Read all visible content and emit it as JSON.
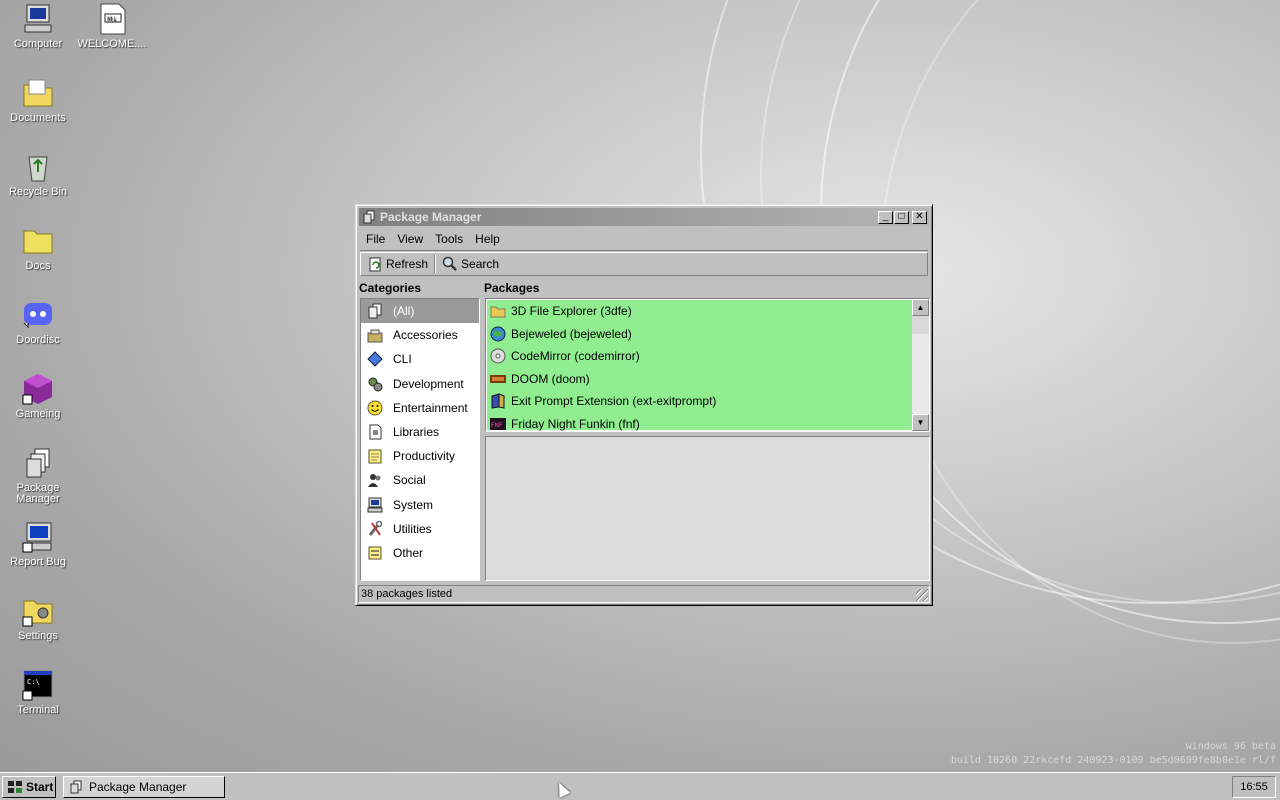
{
  "desktop": {
    "icons": [
      {
        "label": "Computer",
        "icon": "computer-icon"
      },
      {
        "label": "WELCOME....",
        "icon": "markdown-file-icon"
      },
      {
        "label": "Documents",
        "icon": "documents-folder-icon"
      },
      {
        "label": "Recycle Bin",
        "icon": "recycle-bin-icon"
      },
      {
        "label": "Docs",
        "icon": "folder-icon"
      },
      {
        "label": "Doordisc",
        "icon": "discord-icon"
      },
      {
        "label": "Gameing",
        "icon": "game-cube-icon"
      },
      {
        "label": "Package Manager",
        "icon": "package-manager-icon"
      },
      {
        "label": "Report Bug",
        "icon": "report-bug-icon"
      },
      {
        "label": "Settings",
        "icon": "settings-folder-icon"
      },
      {
        "label": "Terminal",
        "icon": "terminal-icon"
      }
    ],
    "watermark_line1": "windows 96 beta",
    "watermark_line2": "build 10260 22rkcefd 240923-0109 be5d0699fe8b0e1e rl/f"
  },
  "window": {
    "title": "Package Manager",
    "menu": [
      "File",
      "View",
      "Tools",
      "Help"
    ],
    "toolbar": {
      "refresh_label": "Refresh",
      "search_label": "Search"
    },
    "categories_heading": "Categories",
    "packages_heading": "Packages",
    "categories": [
      {
        "label": "(All)",
        "icon": "all-icon",
        "selected": true
      },
      {
        "label": "Accessories",
        "icon": "accessories-icon"
      },
      {
        "label": "CLI",
        "icon": "cli-diamond-icon"
      },
      {
        "label": "Development",
        "icon": "development-gears-icon"
      },
      {
        "label": "Entertainment",
        "icon": "smiley-icon"
      },
      {
        "label": "Libraries",
        "icon": "libraries-icon"
      },
      {
        "label": "Productivity",
        "icon": "productivity-notepad-icon"
      },
      {
        "label": "Social",
        "icon": "social-people-icon"
      },
      {
        "label": "System",
        "icon": "system-computer-icon"
      },
      {
        "label": "Utilities",
        "icon": "utilities-tools-icon"
      },
      {
        "label": "Other",
        "icon": "other-icon"
      }
    ],
    "packages": [
      {
        "label": "3D File Explorer (3dfe)",
        "icon": "folder-icon"
      },
      {
        "label": "Bejeweled (bejeweled)",
        "icon": "globe-icon"
      },
      {
        "label": "CodeMirror (codemirror)",
        "icon": "disc-icon"
      },
      {
        "label": "DOOM (doom)",
        "icon": "doom-icon"
      },
      {
        "label": "Exit Prompt Extension (ext-exitprompt)",
        "icon": "book-icon"
      },
      {
        "label": "Friday Night Funkin (fnf)",
        "icon": "fnf-icon"
      }
    ],
    "status": "38 packages listed",
    "list_highlight_color": "#90ee90"
  },
  "taskbar": {
    "start_label": "Start",
    "tasks": [
      {
        "label": "Package Manager"
      }
    ],
    "clock": "16:55"
  }
}
